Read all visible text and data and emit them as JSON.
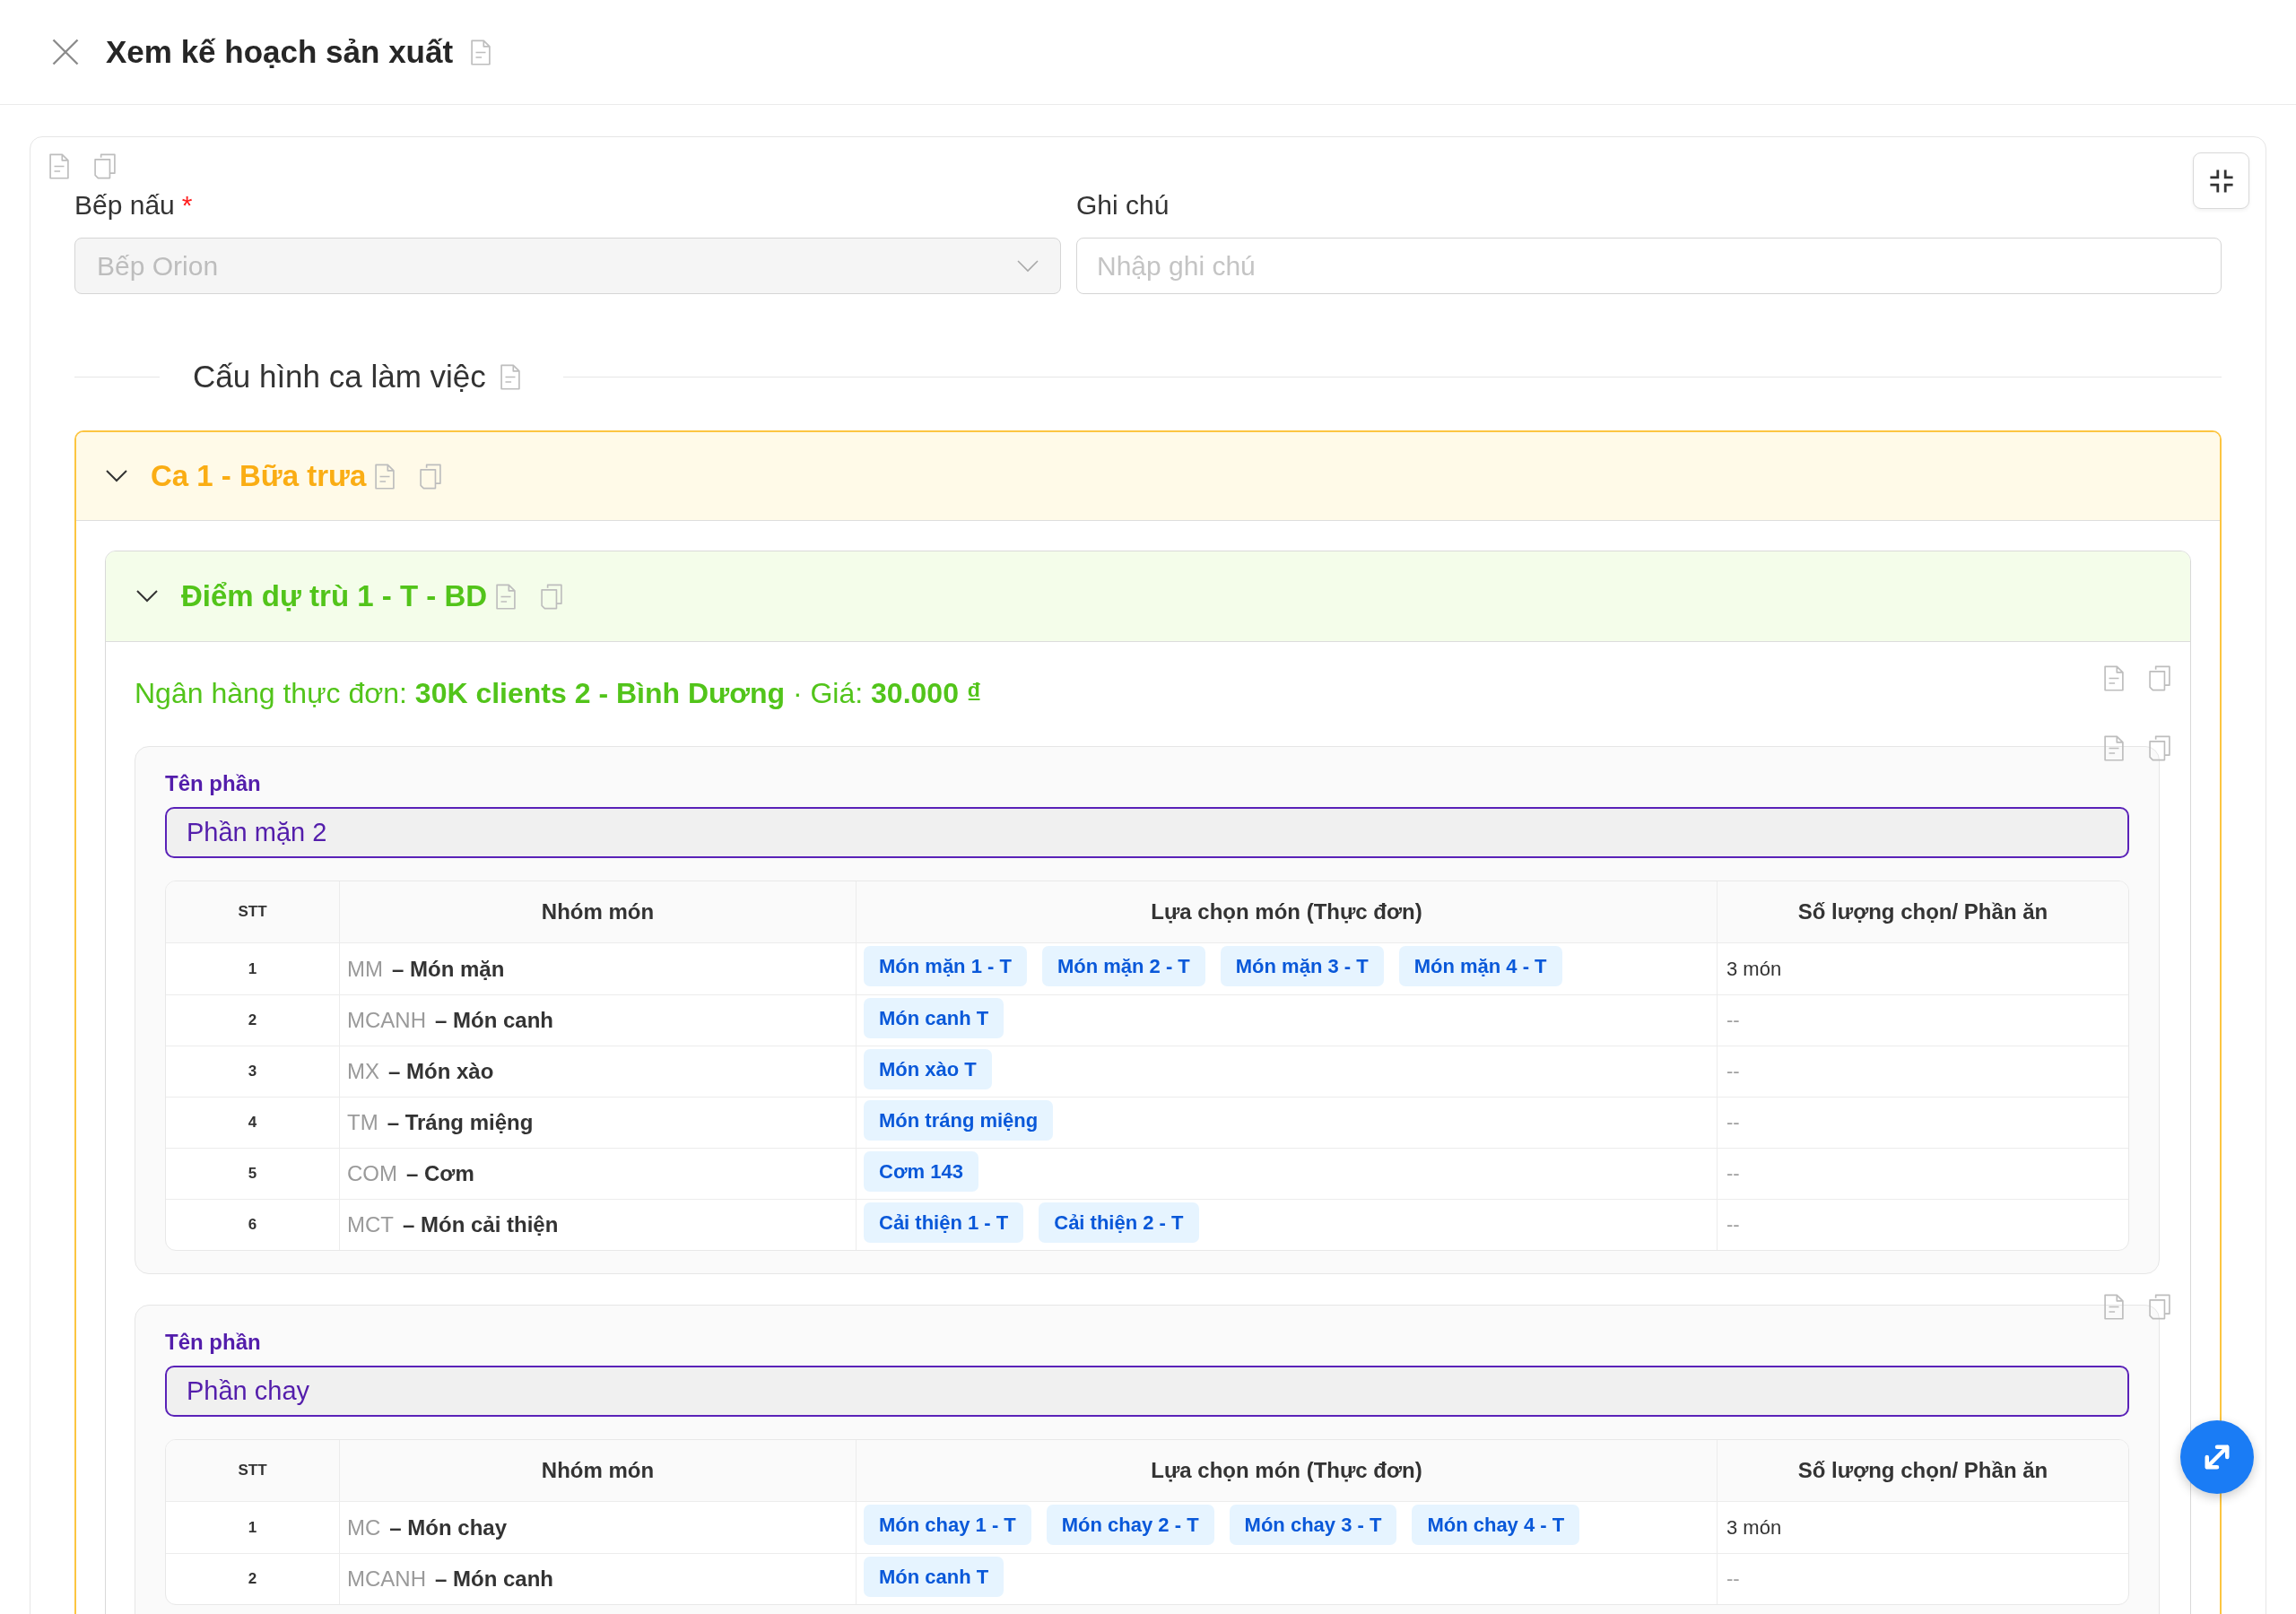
{
  "header": {
    "title": "Xem kế hoạch sản xuất"
  },
  "form": {
    "kitchen": {
      "label": "Bếp nấu",
      "required_mark": "*",
      "value": "Bếp Orion",
      "disabled": true
    },
    "note": {
      "label": "Ghi chú",
      "placeholder": "Nhập ghi chú"
    }
  },
  "section": {
    "title": "Cấu hình ca làm việc"
  },
  "shifts": [
    {
      "title": "Ca 1 - Bữa trưa",
      "expanded": true,
      "points": [
        {
          "title": "Điểm dự trù 1 - T - BD",
          "expanded": true,
          "menu_info": "Ngân hàng thực đơn: **30K clients 2 - Bình Dương** · Giá: **30.000 ₫**",
          "parts": [
            {
              "label": "Tên phần",
              "value": "Phần mặn 2",
              "columns": [
                "STT",
                "Nhóm món",
                "Lựa chọn món (Thực đơn)",
                "Số lượng chọn/ Phần ăn"
              ],
              "rows": [
                {
                  "stt": "1",
                  "code": "MM",
                  "name": "– Món mặn",
                  "dishes": [
                    "Món mặn 1 - T",
                    "Món mặn 2 - T",
                    "Món mặn 3 - T",
                    "Món mặn 4 - T"
                  ],
                  "quantity": "3 món",
                  "quantity_empty": false
                },
                {
                  "stt": "2",
                  "code": "MCANH",
                  "name": "– Món canh",
                  "dishes": [
                    "Món canh T"
                  ],
                  "quantity": "--",
                  "quantity_empty": true
                },
                {
                  "stt": "3",
                  "code": "MX",
                  "name": "– Món xào",
                  "dishes": [
                    "Món xào T"
                  ],
                  "quantity": "--",
                  "quantity_empty": true
                },
                {
                  "stt": "4",
                  "code": "TM",
                  "name": "– Tráng miệng",
                  "dishes": [
                    "Món tráng miệng"
                  ],
                  "quantity": "--",
                  "quantity_empty": true
                },
                {
                  "stt": "5",
                  "code": "COM",
                  "name": "– Cơm",
                  "dishes": [
                    "Cơm 143"
                  ],
                  "quantity": "--",
                  "quantity_empty": true
                },
                {
                  "stt": "6",
                  "code": "MCT",
                  "name": "– Món cải thiện",
                  "dishes": [
                    "Cải thiện 1 - T",
                    "Cải thiện 2 - T"
                  ],
                  "quantity": "--",
                  "quantity_empty": true
                }
              ]
            },
            {
              "label": "Tên phần",
              "value": "Phần chay",
              "columns": [
                "STT",
                "Nhóm món",
                "Lựa chọn món (Thực đơn)",
                "Số lượng chọn/ Phần ăn"
              ],
              "rows": [
                {
                  "stt": "1",
                  "code": "MC",
                  "name": "– Món chay",
                  "dishes": [
                    "Món chay 1 - T",
                    "Món chay 2 - T",
                    "Món chay 3 - T",
                    "Món chay 4 - T"
                  ],
                  "quantity": "3 món",
                  "quantity_empty": false
                },
                {
                  "stt": "2",
                  "code": "MCANH",
                  "name": "– Món canh",
                  "dishes": [
                    "Món canh T"
                  ],
                  "quantity": "--",
                  "quantity_empty": true
                }
              ]
            }
          ]
        }
      ]
    }
  ]
}
